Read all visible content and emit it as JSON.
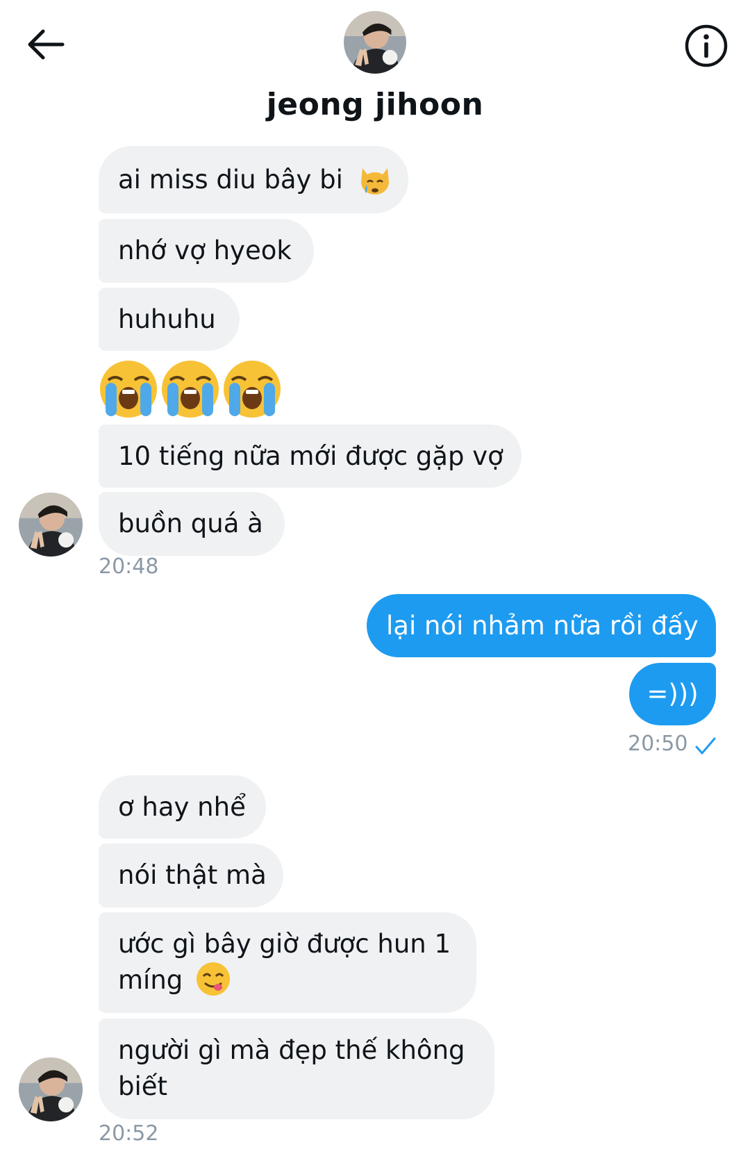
{
  "header": {
    "contact_name": "jeong jihoon",
    "back_icon": "arrow-left-icon",
    "info_icon": "info-circle-icon"
  },
  "messages": {
    "group1": {
      "m1": "ai miss diu bây bi",
      "m2": "nhớ vợ hyeok",
      "m3": "huhuhu",
      "m4_emoji": "😭😭😭",
      "m5": "10 tiếng nữa mới được gặp vợ",
      "m6": "buồn quá à",
      "time": "20:48"
    },
    "group2": {
      "m1": "lại nói nhảm nữa rồi đấy",
      "m2": "=)))",
      "time": "20:50",
      "read_icon": "checkmark-icon"
    },
    "group3": {
      "m1": "ơ hay nhể",
      "m2": "nói thật mà",
      "m3_line1": "ước gì bây giờ được hun 1",
      "m3_line2": "míng",
      "m4_line1": "người gì mà đẹp thế không",
      "m4_line2": "biết",
      "time": "20:52"
    }
  },
  "colors": {
    "sent_bubble": "#1d9bf0",
    "received_bubble": "#eff1f3",
    "timestamp": "#8b98a5"
  }
}
